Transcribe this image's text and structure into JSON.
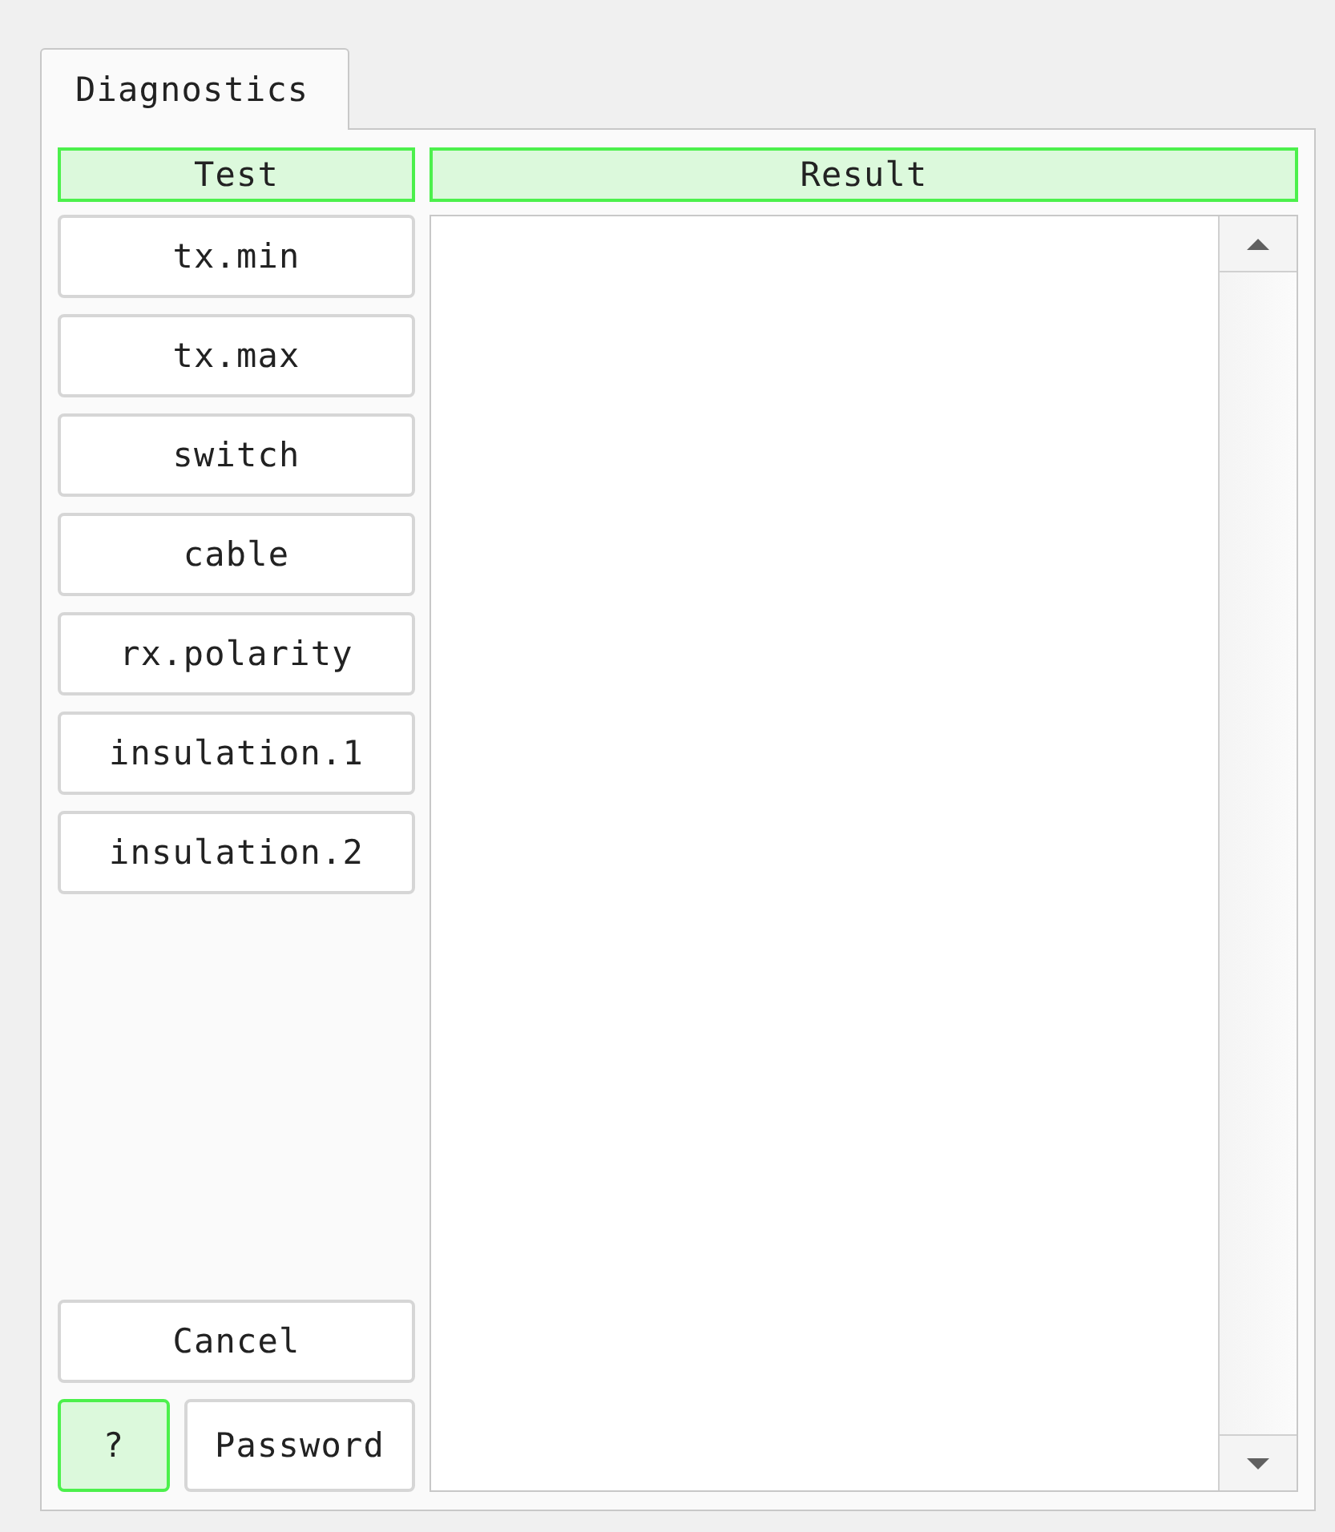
{
  "tabs": [
    {
      "label": "Diagnostics",
      "selected": true
    }
  ],
  "columns": [
    {
      "label": "Test",
      "highlighted": true
    },
    {
      "label": "Result",
      "highlighted": true
    }
  ],
  "tests": [
    {
      "label": "tx.min"
    },
    {
      "label": "tx.max"
    },
    {
      "label": "switch"
    },
    {
      "label": "cable"
    },
    {
      "label": "rx.polarity"
    },
    {
      "label": "insulation.1"
    },
    {
      "label": "insulation.2"
    }
  ],
  "actions": [
    {
      "label": "Cancel",
      "highlighted": false
    }
  ],
  "footer_buttons": [
    {
      "label": "?",
      "highlighted": true
    },
    {
      "label": "Password",
      "highlighted": false
    }
  ]
}
